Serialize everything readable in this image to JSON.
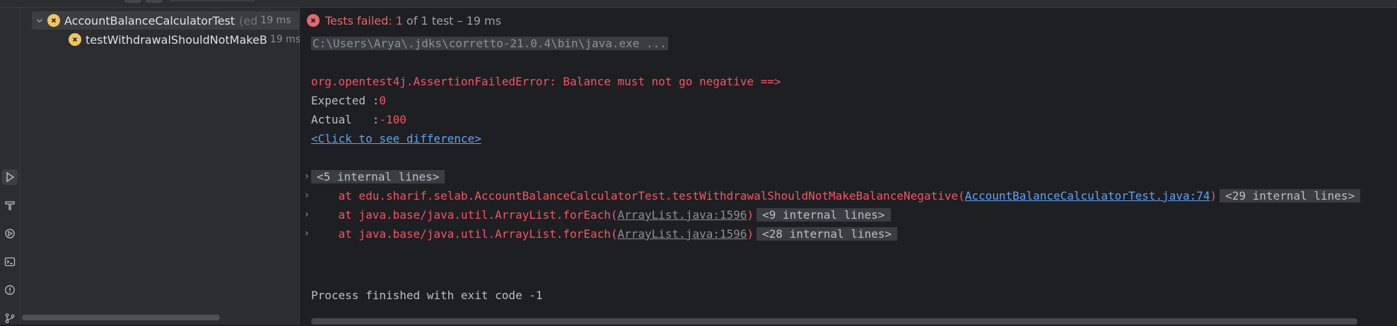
{
  "colors": {
    "fail": "#e5686b",
    "error_text": "#f75464",
    "link": "#5ea2f5",
    "warning_icon": "#f2c55c"
  },
  "tree": {
    "root": {
      "name": "AccountBalanceCalculatorTest",
      "suffix": "(ed",
      "time": "19 ms",
      "icon": "warning-circle-icon"
    },
    "child": {
      "name": "testWithdrawalShouldNotMakeB",
      "time": "19 ms",
      "icon": "warning-circle-icon"
    }
  },
  "status": {
    "failed": "Tests failed: 1",
    "summary": "of 1 test – 19 ms",
    "icon": "failed-icon"
  },
  "console": {
    "command": "C:\\Users\\Arya\\.jdks\\corretto-21.0.4\\bin\\java.exe ...",
    "error": "org.opentest4j.AssertionFailedError: Balance must not go negative ==>",
    "expected_label": "Expected :",
    "expected_value": "0",
    "actual_label": "Actual   :",
    "actual_value": "-100",
    "diff_link": "<Click to see difference>",
    "internal5": "<5 internal lines>",
    "trace1_prefix": "    at edu.sharif.selab.AccountBalanceCalculatorTest.testWithdrawalShouldNotMakeBalanceNegative(",
    "trace1_link": "AccountBalanceCalculatorTest.java:74",
    "trace1_suffix": ")",
    "trace1_internal": "<29 internal lines>",
    "trace2_prefix": "    at java.base/java.util.ArrayList.forEach(",
    "trace2_link": "ArrayList.java:1596",
    "trace2_suffix": ")",
    "trace2_internal": "<9 internal lines>",
    "trace3_prefix": "    at java.base/java.util.ArrayList.forEach(",
    "trace3_link": "ArrayList.java:1596",
    "trace3_suffix": ")",
    "trace3_internal": "<28 internal lines>",
    "exit": "Process finished with exit code -1"
  }
}
